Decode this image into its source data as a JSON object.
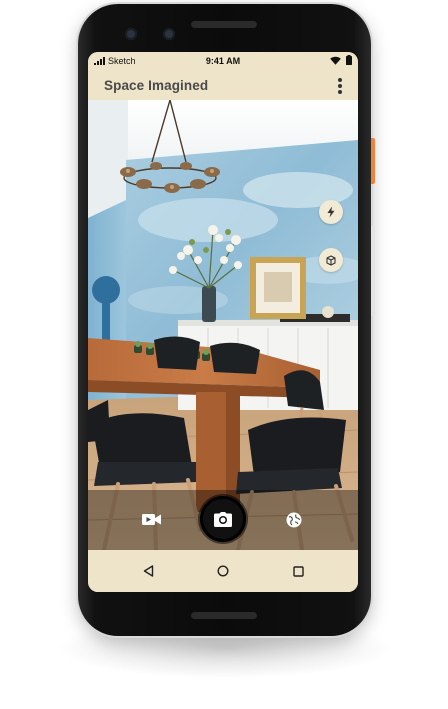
{
  "status_bar": {
    "carrier": "Sketch",
    "time": "9:41 AM"
  },
  "app_bar": {
    "title": "Space Imagined"
  },
  "icons": {
    "flash": "flash-icon",
    "cube": "cube-icon",
    "video": "video-camera-icon",
    "shutter": "camera-icon",
    "globe": "globe-icon",
    "back": "back-triangle-icon",
    "home": "home-circle-icon",
    "recents": "recents-square-icon"
  },
  "colors": {
    "screen_bg": "#ede4c9",
    "title_text": "#4a4a4a",
    "accent_side_button": "#f0823c"
  }
}
